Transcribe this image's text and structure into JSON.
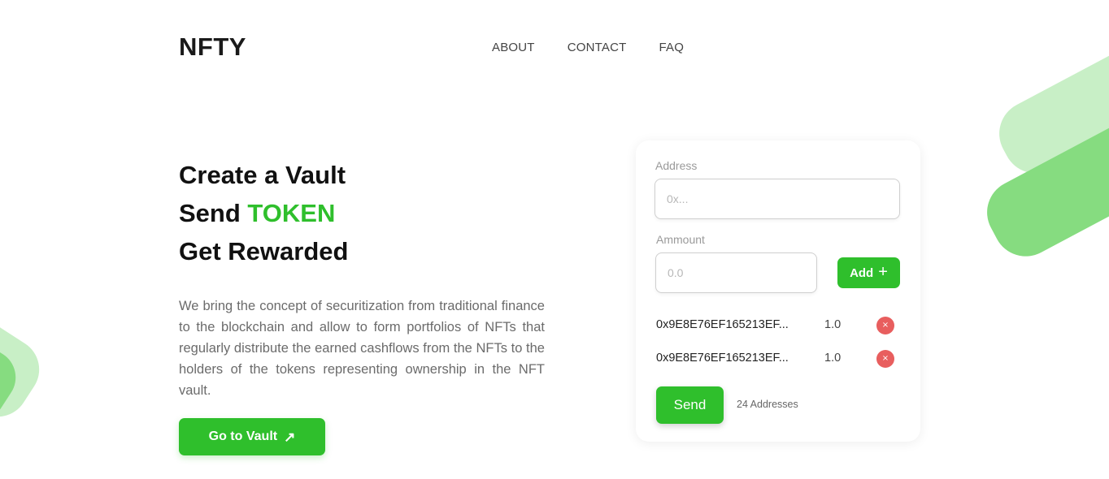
{
  "header": {
    "logo": "NFTY",
    "nav": [
      "ABOUT",
      "CONTACT",
      "FAQ"
    ]
  },
  "hero": {
    "line1": "Create a Vault",
    "line2_prefix": "Send ",
    "line2_accent": "TOKEN",
    "line3": "Get Rewarded",
    "description": "We bring the concept of securitization from traditional finance to the blockchain and allow to form portfolios of NFTs that regularly distribute the earned cashflows from the NFTs to the holders of the tokens representing ownership in the NFT vault.",
    "cta_label": "Go to Vault",
    "cta_icon": "↗"
  },
  "form": {
    "address_label": "Address",
    "address_placeholder": "0x...",
    "amount_label": "Ammount",
    "amount_placeholder": "0.0",
    "add_label": "Add",
    "add_icon": "+",
    "entries": [
      {
        "address": "0x9E8E76EF165213EF...",
        "amount": "1.0",
        "remove_icon": "×"
      },
      {
        "address": "0x9E8E76EF165213EF...",
        "amount": "1.0",
        "remove_icon": "×"
      }
    ],
    "send_label": "Send",
    "count_text": "24 Addresses"
  },
  "colors": {
    "accent": "#2fbf2c",
    "danger": "#e85e5e",
    "deco_light": "#c8efc6",
    "deco_dark": "#86dc80"
  }
}
